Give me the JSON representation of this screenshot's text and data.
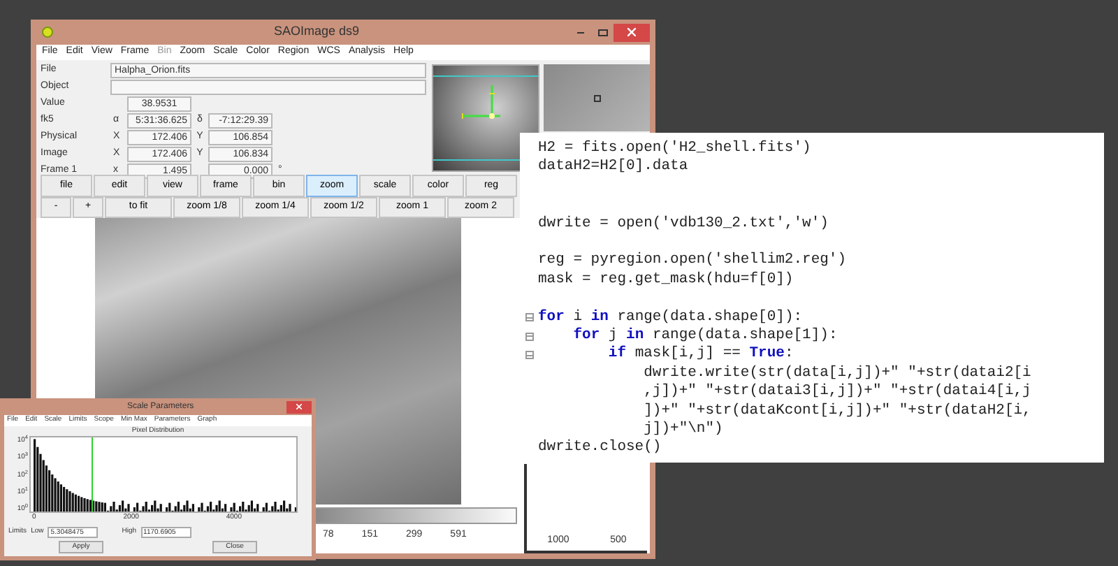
{
  "ds9": {
    "title": "SAOImage ds9",
    "menu": [
      {
        "label": "File",
        "disabled": false
      },
      {
        "label": "Edit",
        "disabled": false
      },
      {
        "label": "View",
        "disabled": false
      },
      {
        "label": "Frame",
        "disabled": false
      },
      {
        "label": "Bin",
        "disabled": true
      },
      {
        "label": "Zoom",
        "disabled": false
      },
      {
        "label": "Scale",
        "disabled": false
      },
      {
        "label": "Color",
        "disabled": false
      },
      {
        "label": "Region",
        "disabled": false
      },
      {
        "label": "WCS",
        "disabled": false
      },
      {
        "label": "Analysis",
        "disabled": false
      },
      {
        "label": "Help",
        "disabled": false
      }
    ],
    "info": {
      "file_label": "File",
      "file": "Halpha_Orion.fits",
      "object_label": "Object",
      "value_label": "Value",
      "value": "38.9531",
      "rows": [
        {
          "label": "fk5",
          "a": "α",
          "a_value": "5:31:36.625",
          "b": "δ",
          "b_value": "-7:12:29.39"
        },
        {
          "label": "Physical",
          "a": "X",
          "a_value": "172.406",
          "b": "Y",
          "b_value": "106.854"
        },
        {
          "label": "Image",
          "a": "X",
          "a_value": "172.406",
          "b": "Y",
          "b_value": "106.834"
        },
        {
          "label": "Frame 1",
          "a": "x",
          "a_value": "1.495",
          "b": "",
          "b_value": "0.000",
          "unit": "°"
        }
      ]
    },
    "buttons": [
      {
        "label": "file",
        "selected": false
      },
      {
        "label": "edit",
        "selected": false
      },
      {
        "label": "view",
        "selected": false
      },
      {
        "label": "frame",
        "selected": false
      },
      {
        "label": "bin",
        "selected": false
      },
      {
        "label": "zoom",
        "selected": true
      },
      {
        "label": "scale",
        "selected": false
      },
      {
        "label": "color",
        "selected": false
      },
      {
        "label": "reg",
        "selected": false
      }
    ],
    "zoom_buttons": [
      "-",
      "+",
      "to fit",
      "zoom 1/8",
      "zoom 1/4",
      "zoom 1/2",
      "zoom 1",
      "zoom 2"
    ],
    "colorbar_ticks": [
      "78",
      "151",
      "299",
      "591"
    ],
    "graph_ticks": [
      "1000",
      "500"
    ]
  },
  "code": [
    {
      "kind": "code",
      "text": "H2 = fits.open('H2_shell.fits')",
      "fold": false
    },
    {
      "kind": "code",
      "text": "dataH2=H2[0].data",
      "fold": false
    },
    {
      "kind": "blank"
    },
    {
      "kind": "blank"
    },
    {
      "kind": "code",
      "text": "dwrite = open('vdb130_2.txt','w')",
      "fold": false
    },
    {
      "kind": "blank"
    },
    {
      "kind": "code",
      "text": "reg = pyregion.open('shellim2.reg')",
      "fold": false
    },
    {
      "kind": "code",
      "text": "mask = reg.get_mask(hdu=f[0])",
      "fold": false
    },
    {
      "kind": "blank"
    },
    {
      "kind": "code",
      "text": "**for** i **in** range(data.shape[0]):",
      "fold": true
    },
    {
      "kind": "code",
      "text": "    **for** j **in** range(data.shape[1]):",
      "fold": true
    },
    {
      "kind": "code",
      "text": "        **if** mask[i,j] == **True**:",
      "fold": true
    },
    {
      "kind": "code",
      "text": "            dwrite.write(str(data[i,j])+\" \"+str(datai2[i",
      "fold": false
    },
    {
      "kind": "code",
      "text": "            ,j])+\" \"+str(datai3[i,j])+\" \"+str(datai4[i,j",
      "fold": false
    },
    {
      "kind": "code",
      "text": "            ])+\" \"+str(dataKcont[i,j])+\" \"+str(dataH2[i,",
      "fold": false
    },
    {
      "kind": "code",
      "text": "            j])+\"\\n\")",
      "fold": false
    },
    {
      "kind": "code",
      "text": "dwrite.close()",
      "fold": false
    }
  ],
  "scale_dialog": {
    "title": "Scale Parameters",
    "menu": [
      "File",
      "Edit",
      "Scale",
      "Limits",
      "Scope",
      "Min Max",
      "Parameters",
      "Graph"
    ],
    "histogram_title": "Pixel Distribution",
    "y_ticks": [
      "10$^{4}$",
      "10$^{3}$",
      "10$^{2}$",
      "10$^{1}$",
      "10$^{0}$"
    ],
    "x_ticks": [
      "0",
      "2000",
      "4000"
    ],
    "limits_label": "Limits",
    "low_label": "Low",
    "low": "5.3048475",
    "high_label": "High",
    "high": "1170.6905",
    "buttons": [
      "Apply",
      "Close"
    ]
  }
}
